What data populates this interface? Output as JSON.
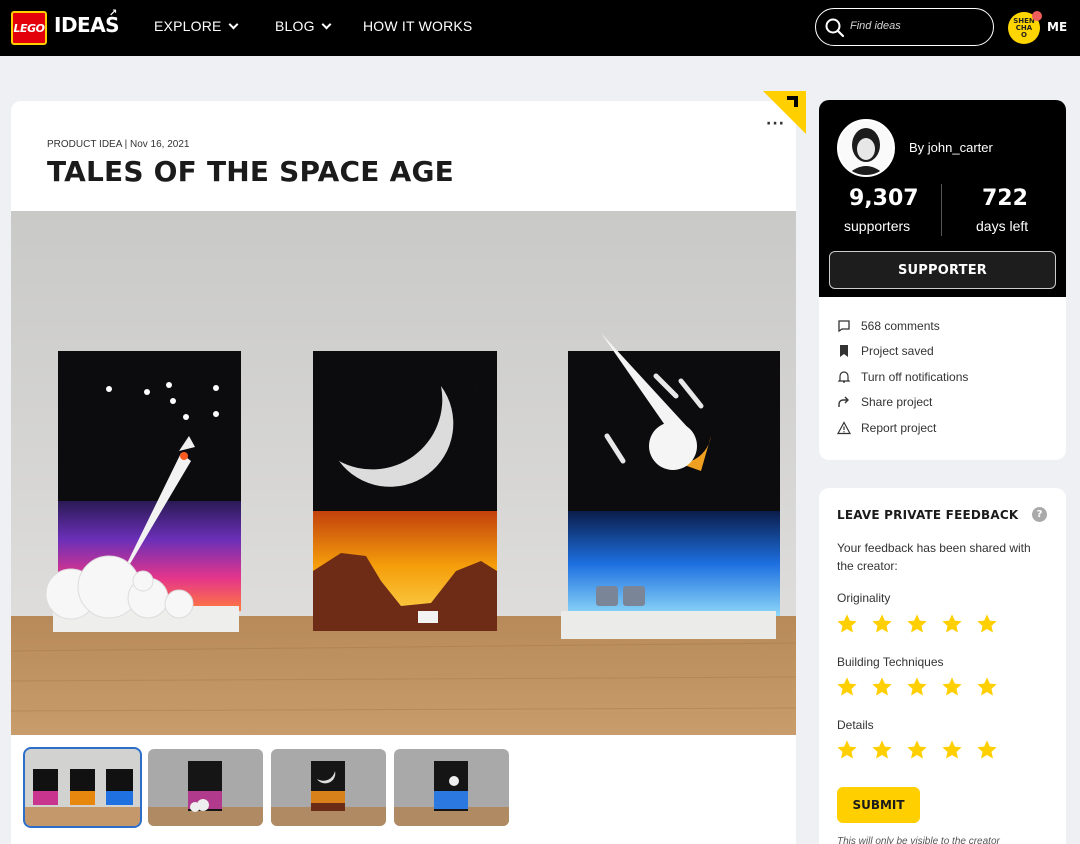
{
  "nav": {
    "logo_lego": "LEGO",
    "logo_ideas": "IDEAS",
    "items": [
      {
        "label": "EXPLORE",
        "has_dropdown": true
      },
      {
        "label": "BLOG",
        "has_dropdown": true
      },
      {
        "label": "HOW IT WORKS",
        "has_dropdown": false
      }
    ],
    "search_placeholder": "Find ideas",
    "user_avatar_text": "SHEN CHAO",
    "user_label": "ME"
  },
  "project": {
    "category": "PRODUCT IDEA",
    "date": "Nov 16, 2021",
    "meta_text": "PRODUCT IDEA | Nov 16, 2021",
    "title": "TALES OF THE SPACE AGE",
    "more_label": "···",
    "thumbnails": [
      "Overview",
      "Rocket panel",
      "Moon panel",
      "Meteor panel"
    ],
    "active_thumbnail": 0
  },
  "creator": {
    "by_label": "By john_carter",
    "supporters_count": "9,307",
    "supporters_label": "supporters",
    "days_left": "722",
    "days_left_label": "days left",
    "supporter_button": "SUPPORTER"
  },
  "actions": [
    {
      "icon": "comment-icon",
      "label": "568 comments"
    },
    {
      "icon": "bookmark-icon",
      "label": "Project saved"
    },
    {
      "icon": "bell-icon",
      "label": "Turn off notifications"
    },
    {
      "icon": "share-icon",
      "label": "Share project"
    },
    {
      "icon": "warning-icon",
      "label": "Report project"
    }
  ],
  "feedback": {
    "title": "LEAVE PRIVATE FEEDBACK",
    "help_icon": "?",
    "description": "Your feedback has been shared with the creator:",
    "criteria": [
      {
        "label": "Originality",
        "rating": 5,
        "max": 5
      },
      {
        "label": "Building Techniques",
        "rating": 5,
        "max": 5
      },
      {
        "label": "Details",
        "rating": 5,
        "max": 5
      }
    ],
    "submit_label": "SUBMIT",
    "fine_print": "This will only be visible to the creator"
  },
  "colors": {
    "accent_yellow": "#ffcf00",
    "lego_red": "#e3000b",
    "thumb_active": "#2d6ec9"
  }
}
